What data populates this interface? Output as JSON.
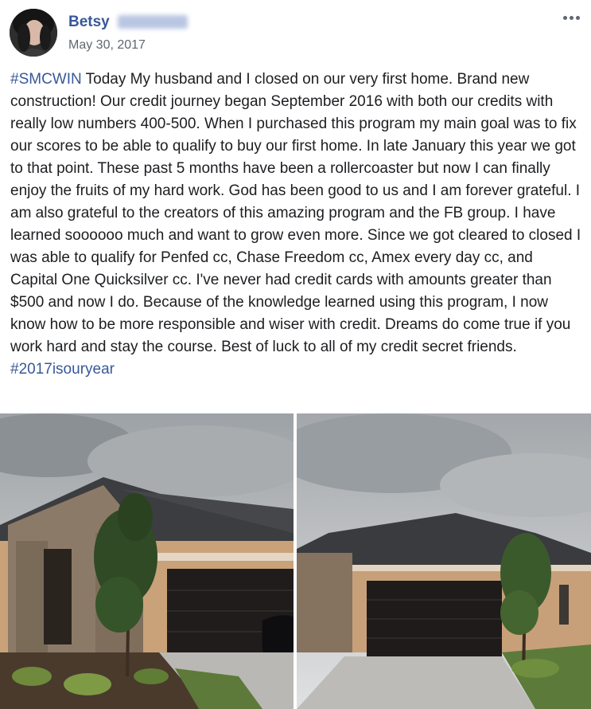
{
  "author": {
    "name": "Betsy"
  },
  "post": {
    "date": "May 30, 2017",
    "hashtag_start": "#SMCWIN",
    "body": " Today My husband and I closed on our very first home. Brand new construction! Our credit journey began September 2016 with both our credits with really low numbers 400-500. When I purchased this program my main goal was to fix our scores to be able to qualify to buy our first home. In late January this year we got to that point. These past 5 months have been a rollercoaster but now I can finally enjoy the fruits of my hard work. God has been good to us and I am forever grateful. I am also grateful to the creators of this amazing program and the FB group. I have learned soooooo much and want to grow even more. Since we got cleared to closed I was able to qualify for Penfed cc, Chase Freedom cc, Amex every day cc, and Capital One Quicksilver cc. I've never had credit cards with amounts greater than $500 and now I do. Because of the knowledge learned using this program, I now know how to be more responsible and wiser with credit. Dreams do come true if you work hard and stay the course. Best of luck to all of my credit secret friends. ",
    "hashtag_end": "#2017isouryear"
  },
  "icons": {
    "more": "more-options-icon"
  },
  "colors": {
    "link": "#385898",
    "meta": "#606770",
    "text": "#1c1e21"
  }
}
